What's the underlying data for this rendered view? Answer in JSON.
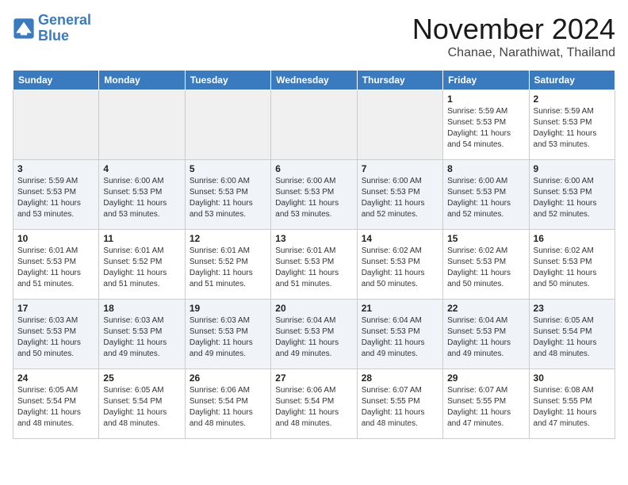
{
  "header": {
    "logo_line1": "General",
    "logo_line2": "Blue",
    "month": "November 2024",
    "location": "Chanae, Narathiwat, Thailand"
  },
  "days_of_week": [
    "Sunday",
    "Monday",
    "Tuesday",
    "Wednesday",
    "Thursday",
    "Friday",
    "Saturday"
  ],
  "weeks": [
    [
      {
        "day": "",
        "info": ""
      },
      {
        "day": "",
        "info": ""
      },
      {
        "day": "",
        "info": ""
      },
      {
        "day": "",
        "info": ""
      },
      {
        "day": "",
        "info": ""
      },
      {
        "day": "1",
        "info": "Sunrise: 5:59 AM\nSunset: 5:53 PM\nDaylight: 11 hours\nand 54 minutes."
      },
      {
        "day": "2",
        "info": "Sunrise: 5:59 AM\nSunset: 5:53 PM\nDaylight: 11 hours\nand 53 minutes."
      }
    ],
    [
      {
        "day": "3",
        "info": "Sunrise: 5:59 AM\nSunset: 5:53 PM\nDaylight: 11 hours\nand 53 minutes."
      },
      {
        "day": "4",
        "info": "Sunrise: 6:00 AM\nSunset: 5:53 PM\nDaylight: 11 hours\nand 53 minutes."
      },
      {
        "day": "5",
        "info": "Sunrise: 6:00 AM\nSunset: 5:53 PM\nDaylight: 11 hours\nand 53 minutes."
      },
      {
        "day": "6",
        "info": "Sunrise: 6:00 AM\nSunset: 5:53 PM\nDaylight: 11 hours\nand 53 minutes."
      },
      {
        "day": "7",
        "info": "Sunrise: 6:00 AM\nSunset: 5:53 PM\nDaylight: 11 hours\nand 52 minutes."
      },
      {
        "day": "8",
        "info": "Sunrise: 6:00 AM\nSunset: 5:53 PM\nDaylight: 11 hours\nand 52 minutes."
      },
      {
        "day": "9",
        "info": "Sunrise: 6:00 AM\nSunset: 5:53 PM\nDaylight: 11 hours\nand 52 minutes."
      }
    ],
    [
      {
        "day": "10",
        "info": "Sunrise: 6:01 AM\nSunset: 5:53 PM\nDaylight: 11 hours\nand 51 minutes."
      },
      {
        "day": "11",
        "info": "Sunrise: 6:01 AM\nSunset: 5:52 PM\nDaylight: 11 hours\nand 51 minutes."
      },
      {
        "day": "12",
        "info": "Sunrise: 6:01 AM\nSunset: 5:52 PM\nDaylight: 11 hours\nand 51 minutes."
      },
      {
        "day": "13",
        "info": "Sunrise: 6:01 AM\nSunset: 5:53 PM\nDaylight: 11 hours\nand 51 minutes."
      },
      {
        "day": "14",
        "info": "Sunrise: 6:02 AM\nSunset: 5:53 PM\nDaylight: 11 hours\nand 50 minutes."
      },
      {
        "day": "15",
        "info": "Sunrise: 6:02 AM\nSunset: 5:53 PM\nDaylight: 11 hours\nand 50 minutes."
      },
      {
        "day": "16",
        "info": "Sunrise: 6:02 AM\nSunset: 5:53 PM\nDaylight: 11 hours\nand 50 minutes."
      }
    ],
    [
      {
        "day": "17",
        "info": "Sunrise: 6:03 AM\nSunset: 5:53 PM\nDaylight: 11 hours\nand 50 minutes."
      },
      {
        "day": "18",
        "info": "Sunrise: 6:03 AM\nSunset: 5:53 PM\nDaylight: 11 hours\nand 49 minutes."
      },
      {
        "day": "19",
        "info": "Sunrise: 6:03 AM\nSunset: 5:53 PM\nDaylight: 11 hours\nand 49 minutes."
      },
      {
        "day": "20",
        "info": "Sunrise: 6:04 AM\nSunset: 5:53 PM\nDaylight: 11 hours\nand 49 minutes."
      },
      {
        "day": "21",
        "info": "Sunrise: 6:04 AM\nSunset: 5:53 PM\nDaylight: 11 hours\nand 49 minutes."
      },
      {
        "day": "22",
        "info": "Sunrise: 6:04 AM\nSunset: 5:53 PM\nDaylight: 11 hours\nand 49 minutes."
      },
      {
        "day": "23",
        "info": "Sunrise: 6:05 AM\nSunset: 5:54 PM\nDaylight: 11 hours\nand 48 minutes."
      }
    ],
    [
      {
        "day": "24",
        "info": "Sunrise: 6:05 AM\nSunset: 5:54 PM\nDaylight: 11 hours\nand 48 minutes."
      },
      {
        "day": "25",
        "info": "Sunrise: 6:05 AM\nSunset: 5:54 PM\nDaylight: 11 hours\nand 48 minutes."
      },
      {
        "day": "26",
        "info": "Sunrise: 6:06 AM\nSunset: 5:54 PM\nDaylight: 11 hours\nand 48 minutes."
      },
      {
        "day": "27",
        "info": "Sunrise: 6:06 AM\nSunset: 5:54 PM\nDaylight: 11 hours\nand 48 minutes."
      },
      {
        "day": "28",
        "info": "Sunrise: 6:07 AM\nSunset: 5:55 PM\nDaylight: 11 hours\nand 48 minutes."
      },
      {
        "day": "29",
        "info": "Sunrise: 6:07 AM\nSunset: 5:55 PM\nDaylight: 11 hours\nand 47 minutes."
      },
      {
        "day": "30",
        "info": "Sunrise: 6:08 AM\nSunset: 5:55 PM\nDaylight: 11 hours\nand 47 minutes."
      }
    ]
  ]
}
